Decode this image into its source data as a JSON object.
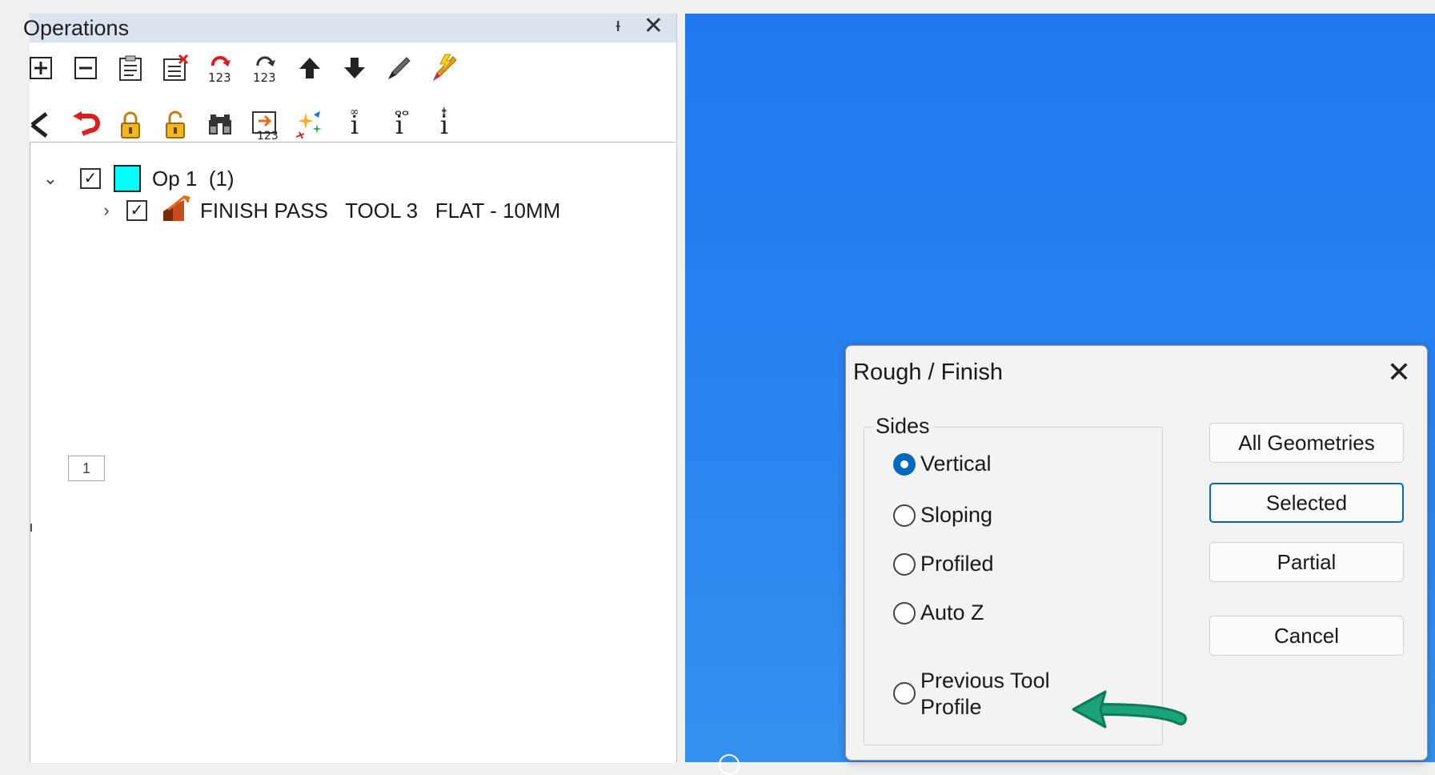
{
  "ops_panel": {
    "title": "Operations",
    "pin_glyph": "ᵻ",
    "close_glyph": "✕",
    "toolbar_row1": [
      "plus-box-icon",
      "minus-box-icon",
      "clipboard-icon",
      "delete-list-icon",
      "renumber-123-icon",
      "renumber-123-alt-icon",
      "arrow-up-icon",
      "arrow-down-icon",
      "pencil-icon",
      "lightning-pencil-icon"
    ],
    "toolbar_row2": [
      "k-icon",
      "undo-icon",
      "lock-icon",
      "unlock-icon",
      "binoculars-icon",
      "list-123-icon",
      "sparkle-icon",
      "info-link-icon",
      "info-binoculars-icon",
      "info-binoculars-arrow-icon"
    ],
    "tree": {
      "op1_label": "Op 1  (1)",
      "finish_label": "FINISH PASS   TOOL 3   FLAT - 10MM"
    },
    "page_badge": "1"
  },
  "dialog": {
    "title": "Rough / Finish",
    "close_glyph": "✕",
    "group_label": "Sides",
    "options": {
      "vertical": "Vertical",
      "sloping": "Sloping",
      "profiled": "Profiled",
      "autoz": "Auto Z",
      "prevtool_line1": "Previous Tool",
      "prevtool_line2": "Profile"
    },
    "selected_option": "Vertical",
    "buttons": {
      "all": "All Geometries",
      "selected": "Selected",
      "partial": "Partial",
      "cancel": "Cancel"
    }
  },
  "colors": {
    "viewport_blue": "#2a84f0",
    "op_swatch": "#00ffff",
    "accent": "#0067c0",
    "arrow_green": "#1aa37a"
  }
}
